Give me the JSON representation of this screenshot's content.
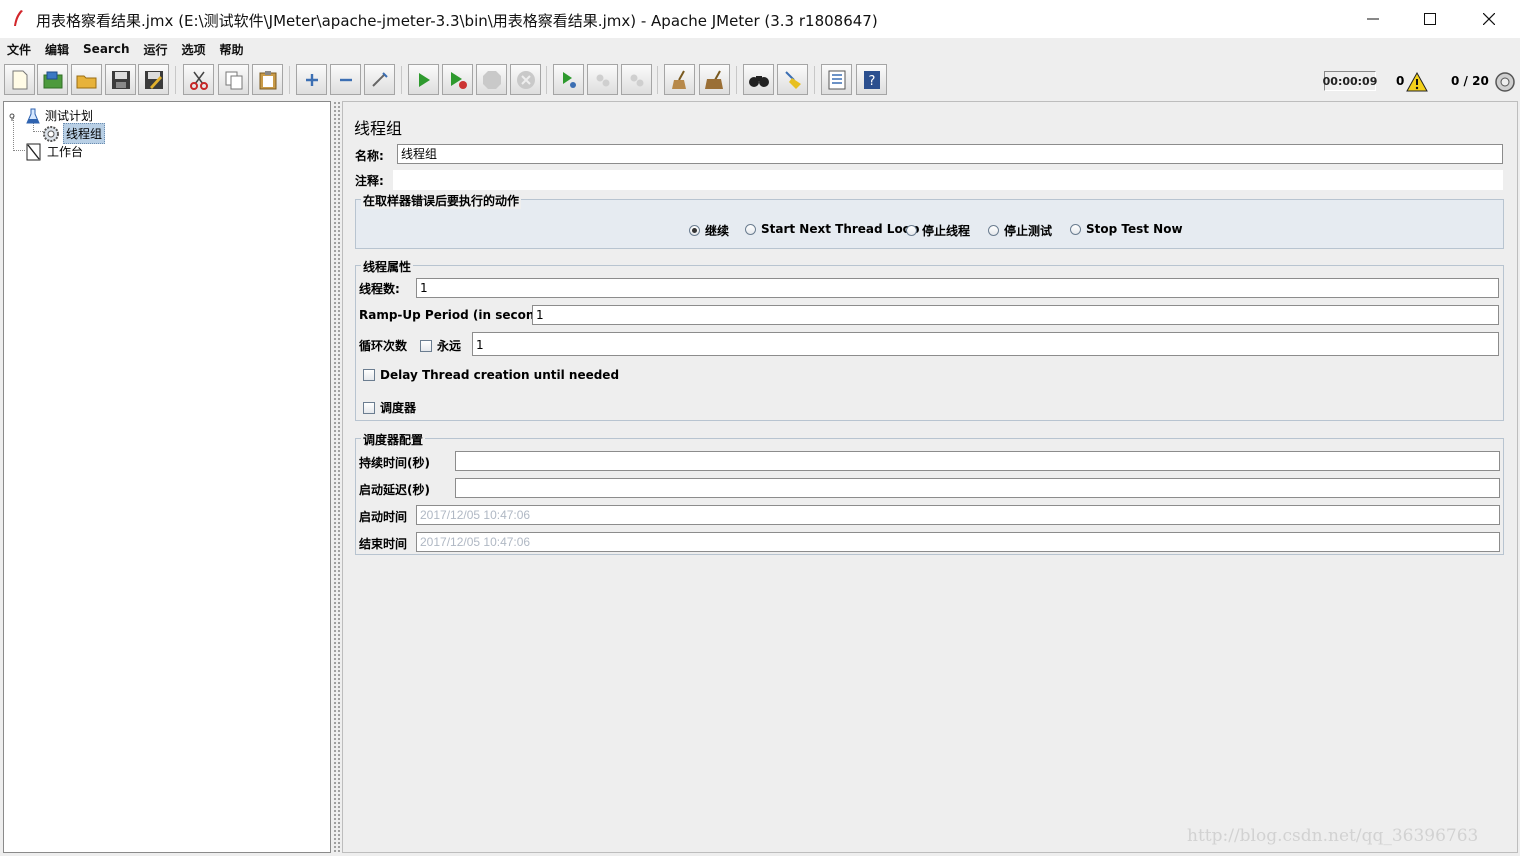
{
  "window": {
    "title": "用表格察看结果.jmx (E:\\测试软件\\JMeter\\apache-jmeter-3.3\\bin\\用表格察看结果.jmx) - Apache JMeter (3.3 r1808647)"
  },
  "menu": [
    "文件",
    "编辑",
    "Search",
    "运行",
    "选项",
    "帮助"
  ],
  "toolbar": {
    "buttons": [
      "new",
      "templates",
      "open",
      "save",
      "save-as",
      "cut",
      "copy",
      "paste",
      "expand",
      "collapse",
      "toggle",
      "start",
      "start-no-pause",
      "stop",
      "shutdown",
      "remote-start",
      "remote-stop",
      "remote-shutdown",
      "clear",
      "clear-all",
      "search",
      "reset-search",
      "function-helper",
      "help"
    ],
    "timer": "00:00:09",
    "error_count": "0",
    "thread_count": "0 / 20"
  },
  "tree": {
    "test_plan": "测试计划",
    "thread_group": "线程组",
    "workbench": "工作台"
  },
  "thread_group": {
    "title": "线程组",
    "name_label": "名称:",
    "name_value": "线程组",
    "comment_label": "注释:",
    "comment_value": "",
    "error_action": {
      "title": "在取样器错误后要执行的动作",
      "options": [
        "继续",
        "Start Next Thread Loop",
        "停止线程",
        "停止测试",
        "Stop Test Now"
      ],
      "selected": "继续"
    },
    "thread_props": {
      "title": "线程属性",
      "threads_label": "线程数:",
      "threads_value": "1",
      "rampup_label": "Ramp-Up Period (in seconds):",
      "rampup_value": "1",
      "loop_label": "循环次数",
      "forever_label": "永远",
      "forever_checked": false,
      "loop_value": "1",
      "delay_label": "Delay Thread creation until needed",
      "delay_checked": false,
      "scheduler_label": "调度器",
      "scheduler_checked": false
    },
    "scheduler_config": {
      "title": "调度器配置",
      "duration_label": "持续时间(秒)",
      "duration_value": "",
      "delay_label": "启动延迟(秒)",
      "delay_value": "",
      "start_label": "启动时间",
      "start_value": "2017/12/05 10:47:06",
      "end_label": "结束时间",
      "end_value": "2017/12/05 10:47:06"
    }
  },
  "watermark": "http://blog.csdn.net/qq_36396763"
}
